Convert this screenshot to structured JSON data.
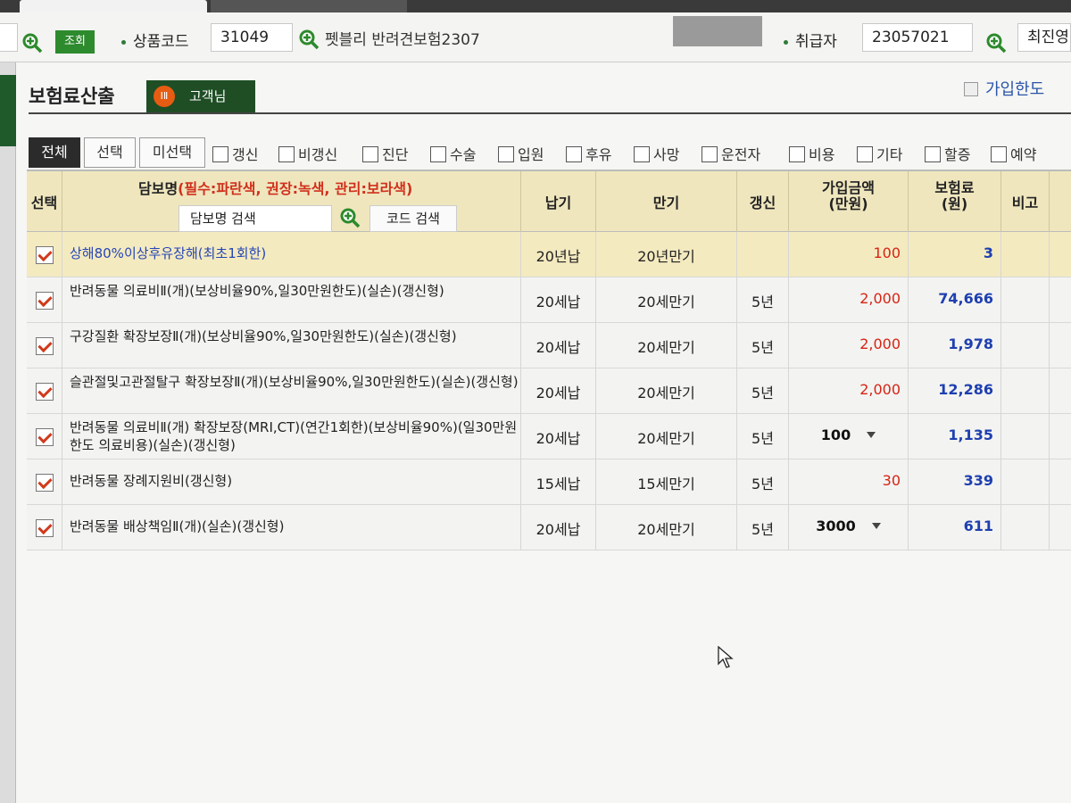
{
  "toolbar": {
    "search_button_label": "조회",
    "product_code_label": "상품코드",
    "product_code_value": "31049",
    "product_name": "펫블리 반려견보험2307",
    "handler_label": "취급자",
    "handler_value": "23057021",
    "recent_label": "최진영"
  },
  "panel": {
    "section_title": "보험료산출",
    "customer_tab": "고객님",
    "customer_badge": "ⅠⅡ",
    "limit_label": "가입한도"
  },
  "filters": {
    "buttons": [
      "전체",
      "선택",
      "미선택"
    ],
    "checks": [
      "갱신",
      "비갱신",
      "진단",
      "수술",
      "입원",
      "후유",
      "사망",
      "운전자",
      "비용",
      "기타",
      "할증",
      "예약"
    ]
  },
  "table": {
    "headers": {
      "select": "선택",
      "name_main": "담보명",
      "name_note": "(필수:파란색, 권장:녹색, 관리:보라색)",
      "name_search": "담보명 검색",
      "code_search": "코드 검색",
      "pay_period": "납기",
      "maturity": "만기",
      "renewal": "갱신",
      "amount_line1": "가입금액",
      "amount_line2": "(만원)",
      "premium_line1": "보험료",
      "premium_line2": "(원)",
      "note": "비고"
    },
    "rows": [
      {
        "name": "상해80%이상후유장해(최초1회한)",
        "pay": "20년납",
        "maturity": "20년만기",
        "renewal": "",
        "amount": "100",
        "premium": "3"
      },
      {
        "name": "반려동물 의료비Ⅱ(개)(보상비율90%,일30만원한도)(실손)(갱신형)",
        "pay": "20세납",
        "maturity": "20세만기",
        "renewal": "5년",
        "amount": "2,000",
        "premium": "74,666"
      },
      {
        "name": "구강질환 확장보장Ⅱ(개)(보상비율90%,일30만원한도)(실손)(갱신형)",
        "pay": "20세납",
        "maturity": "20세만기",
        "renewal": "5년",
        "amount": "2,000",
        "premium": "1,978"
      },
      {
        "name": "슬관절및고관절탈구 확장보장Ⅱ(개)(보상비율90%,일30만원한도)(실손)(갱신형)",
        "pay": "20세납",
        "maturity": "20세만기",
        "renewal": "5년",
        "amount": "2,000",
        "premium": "12,286"
      },
      {
        "name": "반려동물 의료비Ⅱ(개) 확장보장(MRI,CT)(연간1회한)(보상비율90%)(일30만원한도 의료비용)(실손)(갱신형)",
        "pay": "20세납",
        "maturity": "20세만기",
        "renewal": "5년",
        "amount": "100",
        "premium": "1,135"
      },
      {
        "name": "반려동물 장례지원비(갱신형)",
        "pay": "15세납",
        "maturity": "15세만기",
        "renewal": "5년",
        "amount": "30",
        "premium": "339"
      },
      {
        "name": "반려동물 배상책임Ⅱ(개)(실손)(갱신형)",
        "pay": "20세납",
        "maturity": "20세만기",
        "renewal": "5년",
        "amount": "3000",
        "premium": "611"
      }
    ]
  },
  "colors": {
    "accent_green": "#1f4e25",
    "required_blue": "#2545b5",
    "amount_red": "#d52414",
    "premium_blue": "#1e3fb0",
    "header_bg": "#efe6be"
  }
}
